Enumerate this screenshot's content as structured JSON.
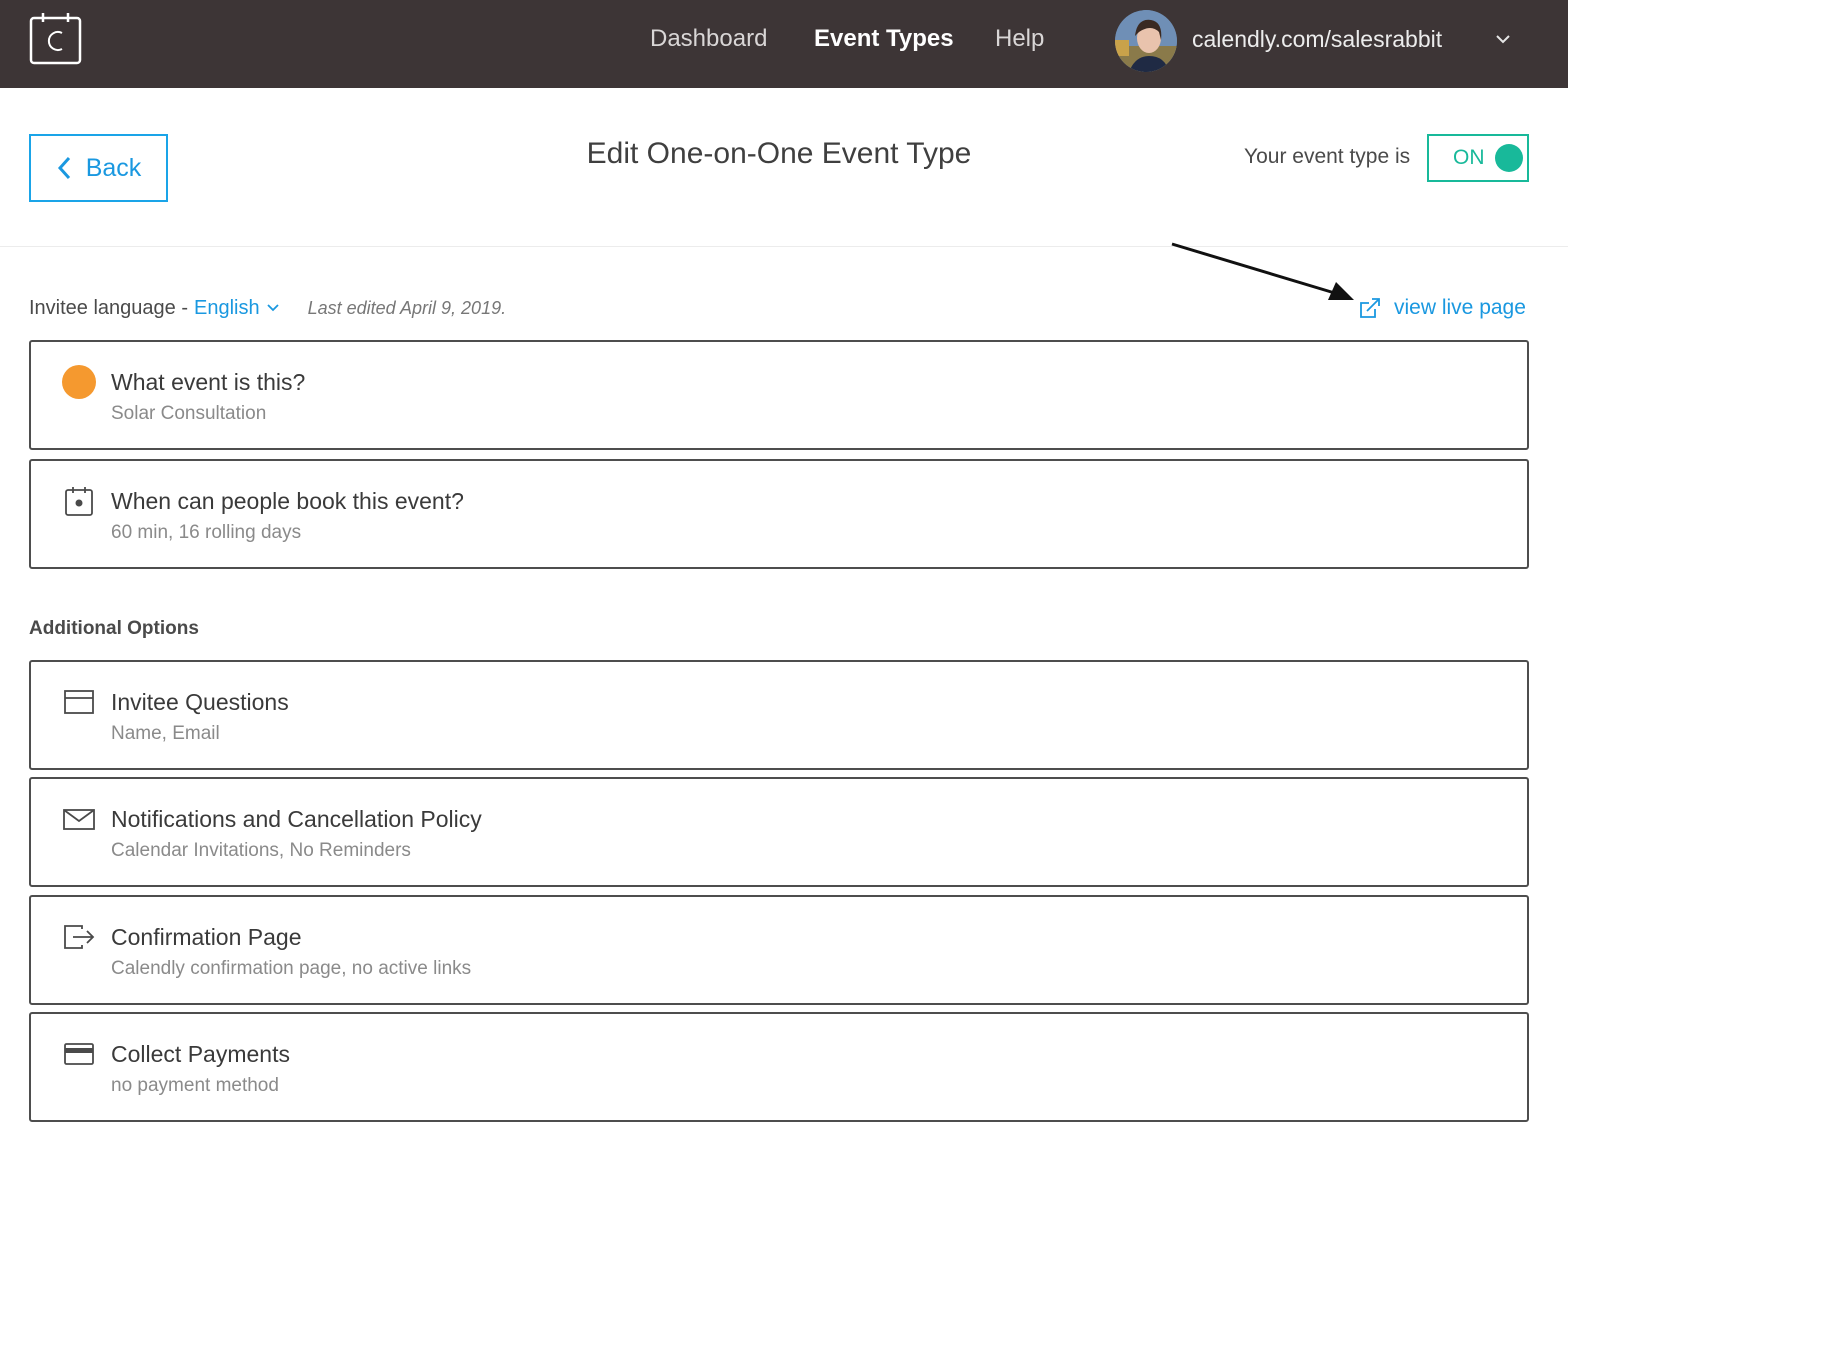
{
  "nav": {
    "links": [
      "Dashboard",
      "Event Types",
      "Help"
    ],
    "active": "Event Types",
    "account_url": "calendly.com/salesrabbit"
  },
  "header": {
    "back_label": "Back",
    "title": "Edit One-on-One Event Type",
    "status_label": "Your event type is",
    "toggle_label": "ON"
  },
  "meta": {
    "language_prefix": "Invitee language -",
    "language_value": "English",
    "last_edited": "Last edited April 9, 2019.",
    "view_live_label": "view live page"
  },
  "main_cards": [
    {
      "title": "What event is this?",
      "subtitle": "Solar Consultation",
      "icon": "orange-dot-icon"
    },
    {
      "title": "When can people book this event?",
      "subtitle": "60 min, 16 rolling days",
      "icon": "calendar-icon"
    }
  ],
  "additional": {
    "heading": "Additional Options",
    "cards": [
      {
        "title": "Invitee Questions",
        "subtitle": "Name, Email",
        "icon": "form-icon"
      },
      {
        "title": "Notifications and Cancellation Policy",
        "subtitle": "Calendar Invitations, No Reminders",
        "icon": "envelope-icon"
      },
      {
        "title": "Confirmation Page",
        "subtitle": "Calendly confirmation page, no active links",
        "icon": "redirect-icon"
      },
      {
        "title": "Collect Payments",
        "subtitle": "no payment method",
        "icon": "credit-card-icon"
      }
    ]
  },
  "colors": {
    "topbar": "#3d3536",
    "accent_blue": "#1a98e0",
    "toggle_green": "#18b99a",
    "event_dot_orange": "#f5992f"
  }
}
